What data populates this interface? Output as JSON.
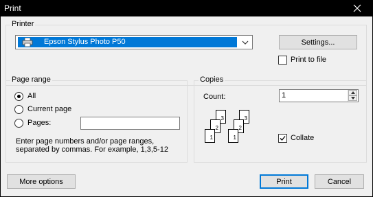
{
  "window": {
    "title": "Print"
  },
  "printer": {
    "group_label": "Printer",
    "selected_printer": "Epson Stylus Photo P50",
    "settings_button": "Settings...",
    "print_to_file_label": "Print to file",
    "print_to_file_checked": false
  },
  "page_range": {
    "group_label": "Page range",
    "options": [
      {
        "label": "All",
        "checked": true
      },
      {
        "label": "Current page",
        "checked": false
      },
      {
        "label": "Pages:",
        "checked": false
      }
    ],
    "pages_value": "",
    "hint_line1": "Enter page numbers and/or page ranges,",
    "hint_line2": "separated by commas. For example, 1,3,5-12"
  },
  "copies": {
    "group_label": "Copies",
    "count_label": "Count:",
    "count_value": "1",
    "collate_label": "Collate",
    "collate_checked": true,
    "collate_pages": [
      "1",
      "2",
      "3"
    ]
  },
  "footer": {
    "more_options_button": "More options",
    "print_button": "Print",
    "cancel_button": "Cancel"
  }
}
